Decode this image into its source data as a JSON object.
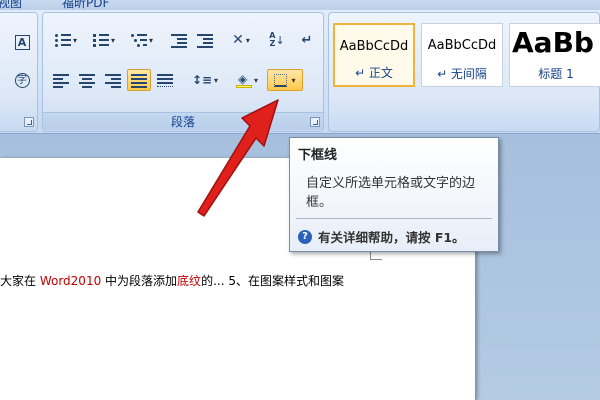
{
  "tabs": [
    "视图",
    "福昕PDF"
  ],
  "paragraph_group": {
    "label": "段落",
    "buttons": [
      "bullets",
      "numbering",
      "multilevel-list",
      "decrease-indent",
      "increase-indent",
      "chinese-layout",
      "sort",
      "show-marks",
      "align-left",
      "center",
      "align-right",
      "justify",
      "distributed",
      "line-spacing",
      "shading",
      "bottom-border"
    ]
  },
  "font_group": {
    "buttons": [
      "character-border",
      "enclose-characters"
    ]
  },
  "styles": [
    {
      "sample": "AaBbCcDd",
      "name": "↵ 正文"
    },
    {
      "sample": "AaBbCcDd",
      "name": "↵ 无间隔"
    },
    {
      "sample": "AaBb",
      "name": "标题 1"
    }
  ],
  "tooltip": {
    "title": "下框线",
    "body": "自定义所选单元格或文字的边框。",
    "help": "有关详细帮助，请按 F1。"
  },
  "document": {
    "line_prefix": "大家在 ",
    "line_red1": "Word2010",
    "line_mid": " 中为段落添加",
    "line_red2": "底纹",
    "line_suffix": "的... 5、在图案样式和图案"
  },
  "colors": {
    "arrow": "#e0201a",
    "accent_highlight": "#ffc84a",
    "ribbon_text": "#15428b"
  }
}
